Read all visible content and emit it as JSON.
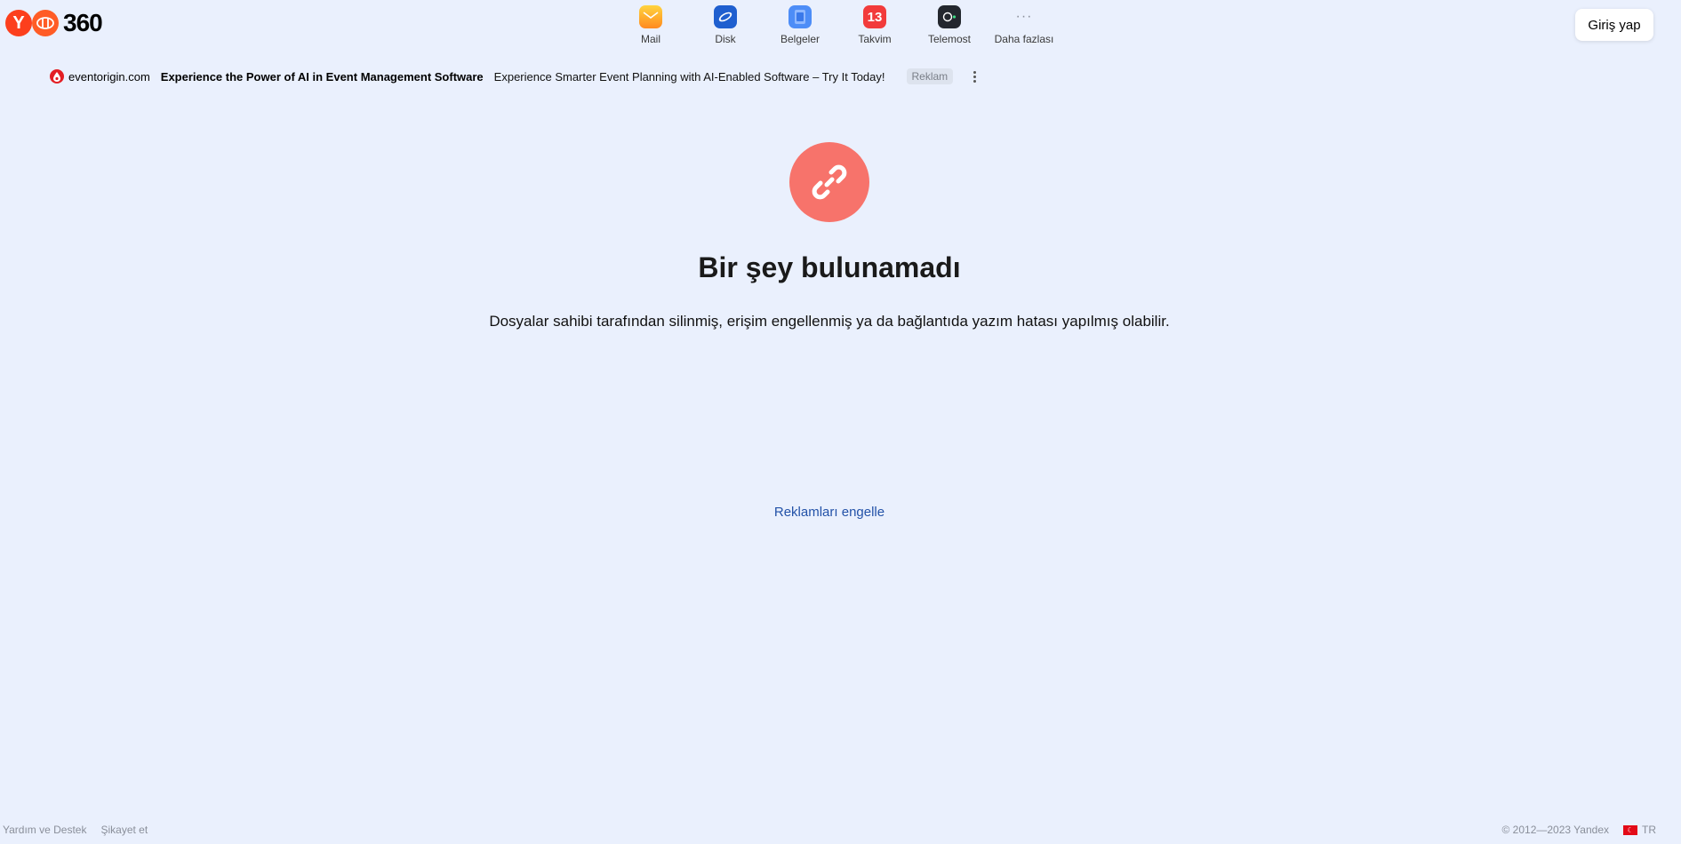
{
  "header": {
    "logo": {
      "text": "360"
    },
    "services": [
      {
        "label": "Mail",
        "icon": "mail-icon"
      },
      {
        "label": "Disk",
        "icon": "disk-icon"
      },
      {
        "label": "Belgeler",
        "icon": "docs-icon"
      },
      {
        "label": "Takvim",
        "icon": "calendar-icon",
        "badge": "13"
      },
      {
        "label": "Telemost",
        "icon": "telemost-icon"
      },
      {
        "label": "Daha fazlası",
        "icon": "more-icon",
        "glyph": "···"
      }
    ],
    "login_label": "Giriş yap"
  },
  "ad": {
    "domain": "eventorigin.com",
    "title": "Experience the Power of AI in Event Management Software",
    "text": "Experience Smarter Event Planning with AI-Enabled Software – Try It Today!",
    "badge": "Reklam"
  },
  "main": {
    "title": "Bir şey bulunamadı",
    "description": "Dosyalar sahibi tarafından silinmiş, erişim engellenmiş ya da bağlantıda yazım hatası yapılmış olabilir.",
    "block_ads_link": "Reklamları engelle"
  },
  "footer": {
    "help": "Yardım ve Destek",
    "complain": "Şikayet et",
    "copyright": "© 2012—2023 Yandex",
    "lang": "TR"
  },
  "colors": {
    "background": "#eaf0fd",
    "error_icon": "#f7736b",
    "link": "#2352a8",
    "brand": "#fc3f1d"
  }
}
